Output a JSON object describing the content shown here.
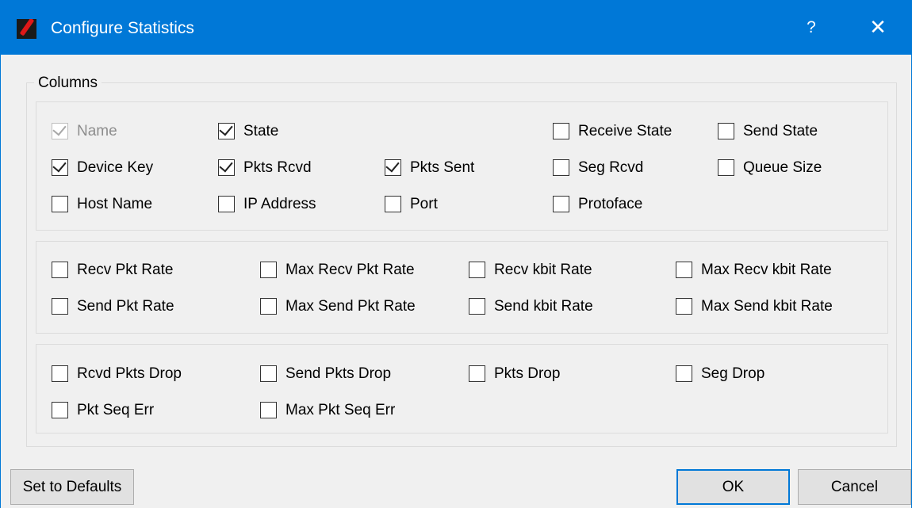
{
  "window": {
    "title": "Configure Statistics",
    "icon": "application-logo-icon",
    "help_label": "?",
    "close_label": "✕"
  },
  "groupbox": {
    "title": "Columns"
  },
  "checkboxes": [
    {
      "label": "Name",
      "checked": true,
      "disabled": true
    },
    {
      "label": "State",
      "checked": true,
      "disabled": false
    },
    {
      "label": "Receive State",
      "checked": false,
      "disabled": false
    },
    {
      "label": "Send State",
      "checked": false,
      "disabled": false
    },
    {
      "label": "Device Key",
      "checked": true,
      "disabled": false
    },
    {
      "label": "Pkts Rcvd",
      "checked": true,
      "disabled": false
    },
    {
      "label": "Pkts Sent",
      "checked": true,
      "disabled": false
    },
    {
      "label": "Seg Rcvd",
      "checked": false,
      "disabled": false
    },
    {
      "label": "Queue Size",
      "checked": false,
      "disabled": false
    },
    {
      "label": "Host Name",
      "checked": false,
      "disabled": false
    },
    {
      "label": "IP Address",
      "checked": false,
      "disabled": false
    },
    {
      "label": "Port",
      "checked": false,
      "disabled": false
    },
    {
      "label": "Protoface",
      "checked": false,
      "disabled": false
    },
    {
      "label": "Recv Pkt Rate",
      "checked": false,
      "disabled": false
    },
    {
      "label": "Max Recv Pkt Rate",
      "checked": false,
      "disabled": false
    },
    {
      "label": "Recv kbit Rate",
      "checked": false,
      "disabled": false
    },
    {
      "label": "Max Recv kbit Rate",
      "checked": false,
      "disabled": false
    },
    {
      "label": "Send Pkt Rate",
      "checked": false,
      "disabled": false
    },
    {
      "label": "Max Send Pkt Rate",
      "checked": false,
      "disabled": false
    },
    {
      "label": "Send kbit Rate",
      "checked": false,
      "disabled": false
    },
    {
      "label": "Max Send kbit Rate",
      "checked": false,
      "disabled": false
    },
    {
      "label": "Rcvd Pkts Drop",
      "checked": false,
      "disabled": false
    },
    {
      "label": "Send Pkts Drop",
      "checked": false,
      "disabled": false
    },
    {
      "label": "Pkts Drop",
      "checked": false,
      "disabled": false
    },
    {
      "label": "Seg Drop",
      "checked": false,
      "disabled": false
    },
    {
      "label": "Pkt Seq Err",
      "checked": false,
      "disabled": false
    },
    {
      "label": "Max Pkt Seq Err",
      "checked": false,
      "disabled": false
    }
  ],
  "buttons": {
    "defaults": "Set to Defaults",
    "ok": "OK",
    "cancel": "Cancel"
  },
  "colors": {
    "title_bar": "#0078d7",
    "background": "#f0f0f0",
    "button_face": "#e1e1e1"
  }
}
